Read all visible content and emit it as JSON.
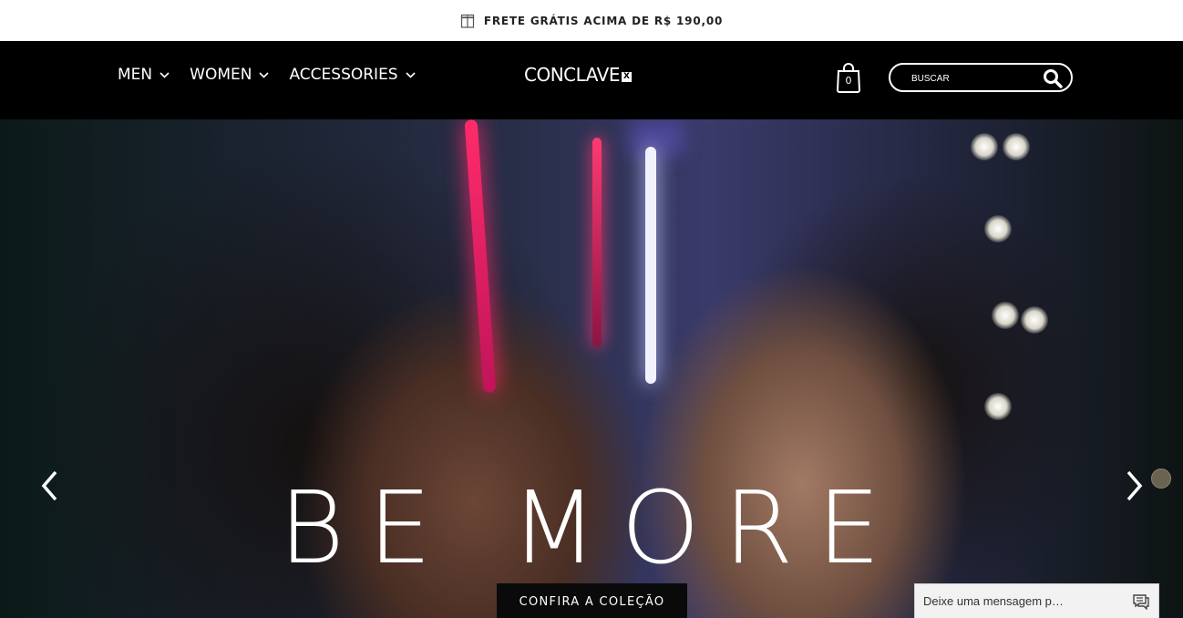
{
  "promo": {
    "text": "FRETE GRÁTIS ACIMA DE R$ 190,00",
    "icon": "gift-box-icon"
  },
  "nav": {
    "items": [
      {
        "label": "MEN"
      },
      {
        "label": "WOMEN"
      },
      {
        "label": "ACCESSORIES"
      }
    ]
  },
  "logo": {
    "text": "CONCLAVE",
    "badge": "X"
  },
  "cart": {
    "count": "0",
    "icon": "shopping-bag-icon"
  },
  "search": {
    "placeholder": "BUSCAR",
    "icon": "search-icon"
  },
  "hero": {
    "title": "BE MORE",
    "cta_label": "CONFIRA A COLEÇÃO"
  },
  "chat": {
    "placeholder": "Deixe uma mensagem p…",
    "icon": "chat-bubble-icon"
  },
  "colors": {
    "header_bg": "#000000",
    "promo_bg": "#ffffff",
    "text_light": "#ffffff",
    "promo_text": "#222222"
  }
}
